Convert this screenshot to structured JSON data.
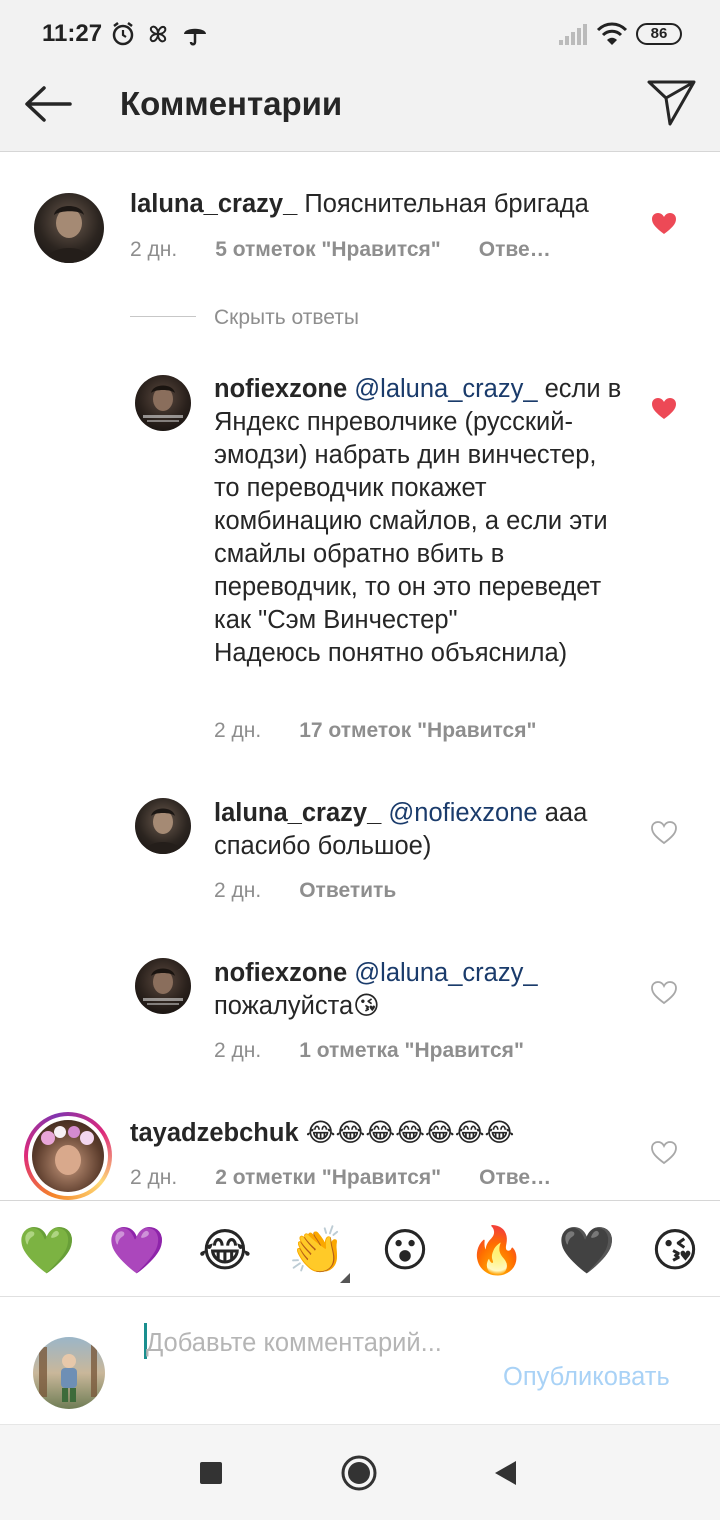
{
  "status_bar": {
    "time": "11:27",
    "battery": "86",
    "icons": [
      "alarm-icon",
      "pinwheel-icon",
      "umbrella-icon",
      "signal-icon",
      "wifi-icon"
    ]
  },
  "header": {
    "title": "Комментарии",
    "back_icon": "arrow-left-icon",
    "share_icon": "send-icon"
  },
  "comments": [
    {
      "username": "laluna_crazy_",
      "mention": "",
      "text": "Пояснительная бригада",
      "time": "2 дн.",
      "likes": "5 отметок \"Нравится\"",
      "reply": "Отве…",
      "liked": true
    },
    {
      "username": "nofiexzone",
      "mention": "@laluna_crazy_",
      "text": "если в Яндекс пнреволчике (русский-эмодзи) набрать дин винчестер, то переводчик покажет комбинацию смайлов, а если эти смайлы обратно вбить в переводчик, то он это переведет как \"Сэм Винчестер\"",
      "text2": "Надеюсь понятно объяснила)",
      "time": "2 дн.",
      "likes": "17 отметок \"Нравится\"",
      "reply": "",
      "liked": true
    },
    {
      "username": "laluna_crazy_",
      "mention": "@nofiexzone",
      "text": "ааа спасибо большое)",
      "time": "2 дн.",
      "likes": "",
      "reply": "Ответить",
      "liked": false
    },
    {
      "username": "nofiexzone",
      "mention": "@laluna_crazy_",
      "text": "пожалуйста😘",
      "time": "2 дн.",
      "likes": "1 отметка \"Нравится\"",
      "reply": "",
      "liked": false
    },
    {
      "username": "tayadzebchuk",
      "mention": "",
      "text": "😂😂😂😂😂😂😂",
      "time": "2 дн.",
      "likes": "2 отметки \"Нравится\"",
      "reply": "Отве…",
      "liked": false
    }
  ],
  "hide_replies": "Скрыть ответы",
  "emoji_bar": [
    "💚",
    "💜",
    "😂",
    "👏",
    "😮",
    "🔥",
    "🖤",
    "😘"
  ],
  "composer": {
    "placeholder": "Добавьте комментарий...",
    "publish": "Опубликовать"
  },
  "colors": {
    "liked_heart": "#ed4956",
    "mention": "#1a3b6b",
    "publish_disabled": "#a9d2f6",
    "meta_gray": "#8e8e8e"
  }
}
